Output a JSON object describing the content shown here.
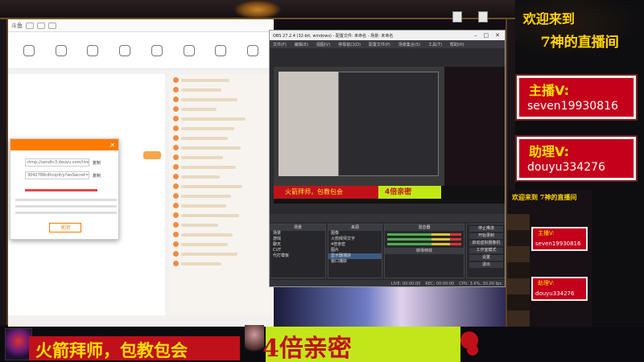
{
  "welcome": {
    "line1": "欢迎来到",
    "line2": "7神的直播间"
  },
  "anchor": {
    "label": "主播V:",
    "value": "seven19930816"
  },
  "assistant": {
    "label": "助理V:",
    "value": "douyu334276"
  },
  "banner": {
    "red_text": "火箭拜师，包教包会",
    "green_text": "4倍亲密"
  },
  "browser": {
    "site": "斗鱼",
    "nav": [
      "",
      "",
      "",
      "",
      "",
      "",
      "",
      ""
    ],
    "pill": "高清",
    "dialog": {
      "url1": "rtmp://sendtc3.douyu.com/live",
      "url2": "3042786rdhcqrit/y?wsSecret=",
      "copy": "复制",
      "confirm": "关闭"
    }
  },
  "obs": {
    "title": "OBS 27.2.4 (32-bit, windows) - 配置文件: 未命名 - 场景: 未命名",
    "menu": [
      "文件(F)",
      "编辑(E)",
      "视图(V)",
      "停靠窗口(D)",
      "配置文件(P)",
      "场景集合(S)",
      "工具(T)",
      "帮助(H)"
    ],
    "scenes_head": "场景",
    "sources_head": "来源",
    "mixer_head": "混音器",
    "transition_head": "转场特效",
    "controls_head": "控件",
    "scenes": [
      "场景",
      "游戏",
      "聊天",
      "CUT",
      "代打模板"
    ],
    "sources": [
      "图像",
      "火箭拜师文字",
      "4倍亲密",
      "图片",
      "显示器捕获",
      "窗口捕获"
    ],
    "controls": [
      "停止推流",
      "开始录制",
      "启动虚拟摄像机",
      "工作室模式",
      "设置",
      "退出"
    ],
    "status": [
      "LIVE: 00:00:00",
      "REC: 00:00:00",
      "CPU: 3.6%, 30.00 fps"
    ]
  },
  "nested": {
    "welcome": "欢迎来到 7神的直播间",
    "anchor_label": "主播V:",
    "anchor_value": "seven19930816",
    "assist_label": "助理V:",
    "assist_value": "douyu334276"
  }
}
